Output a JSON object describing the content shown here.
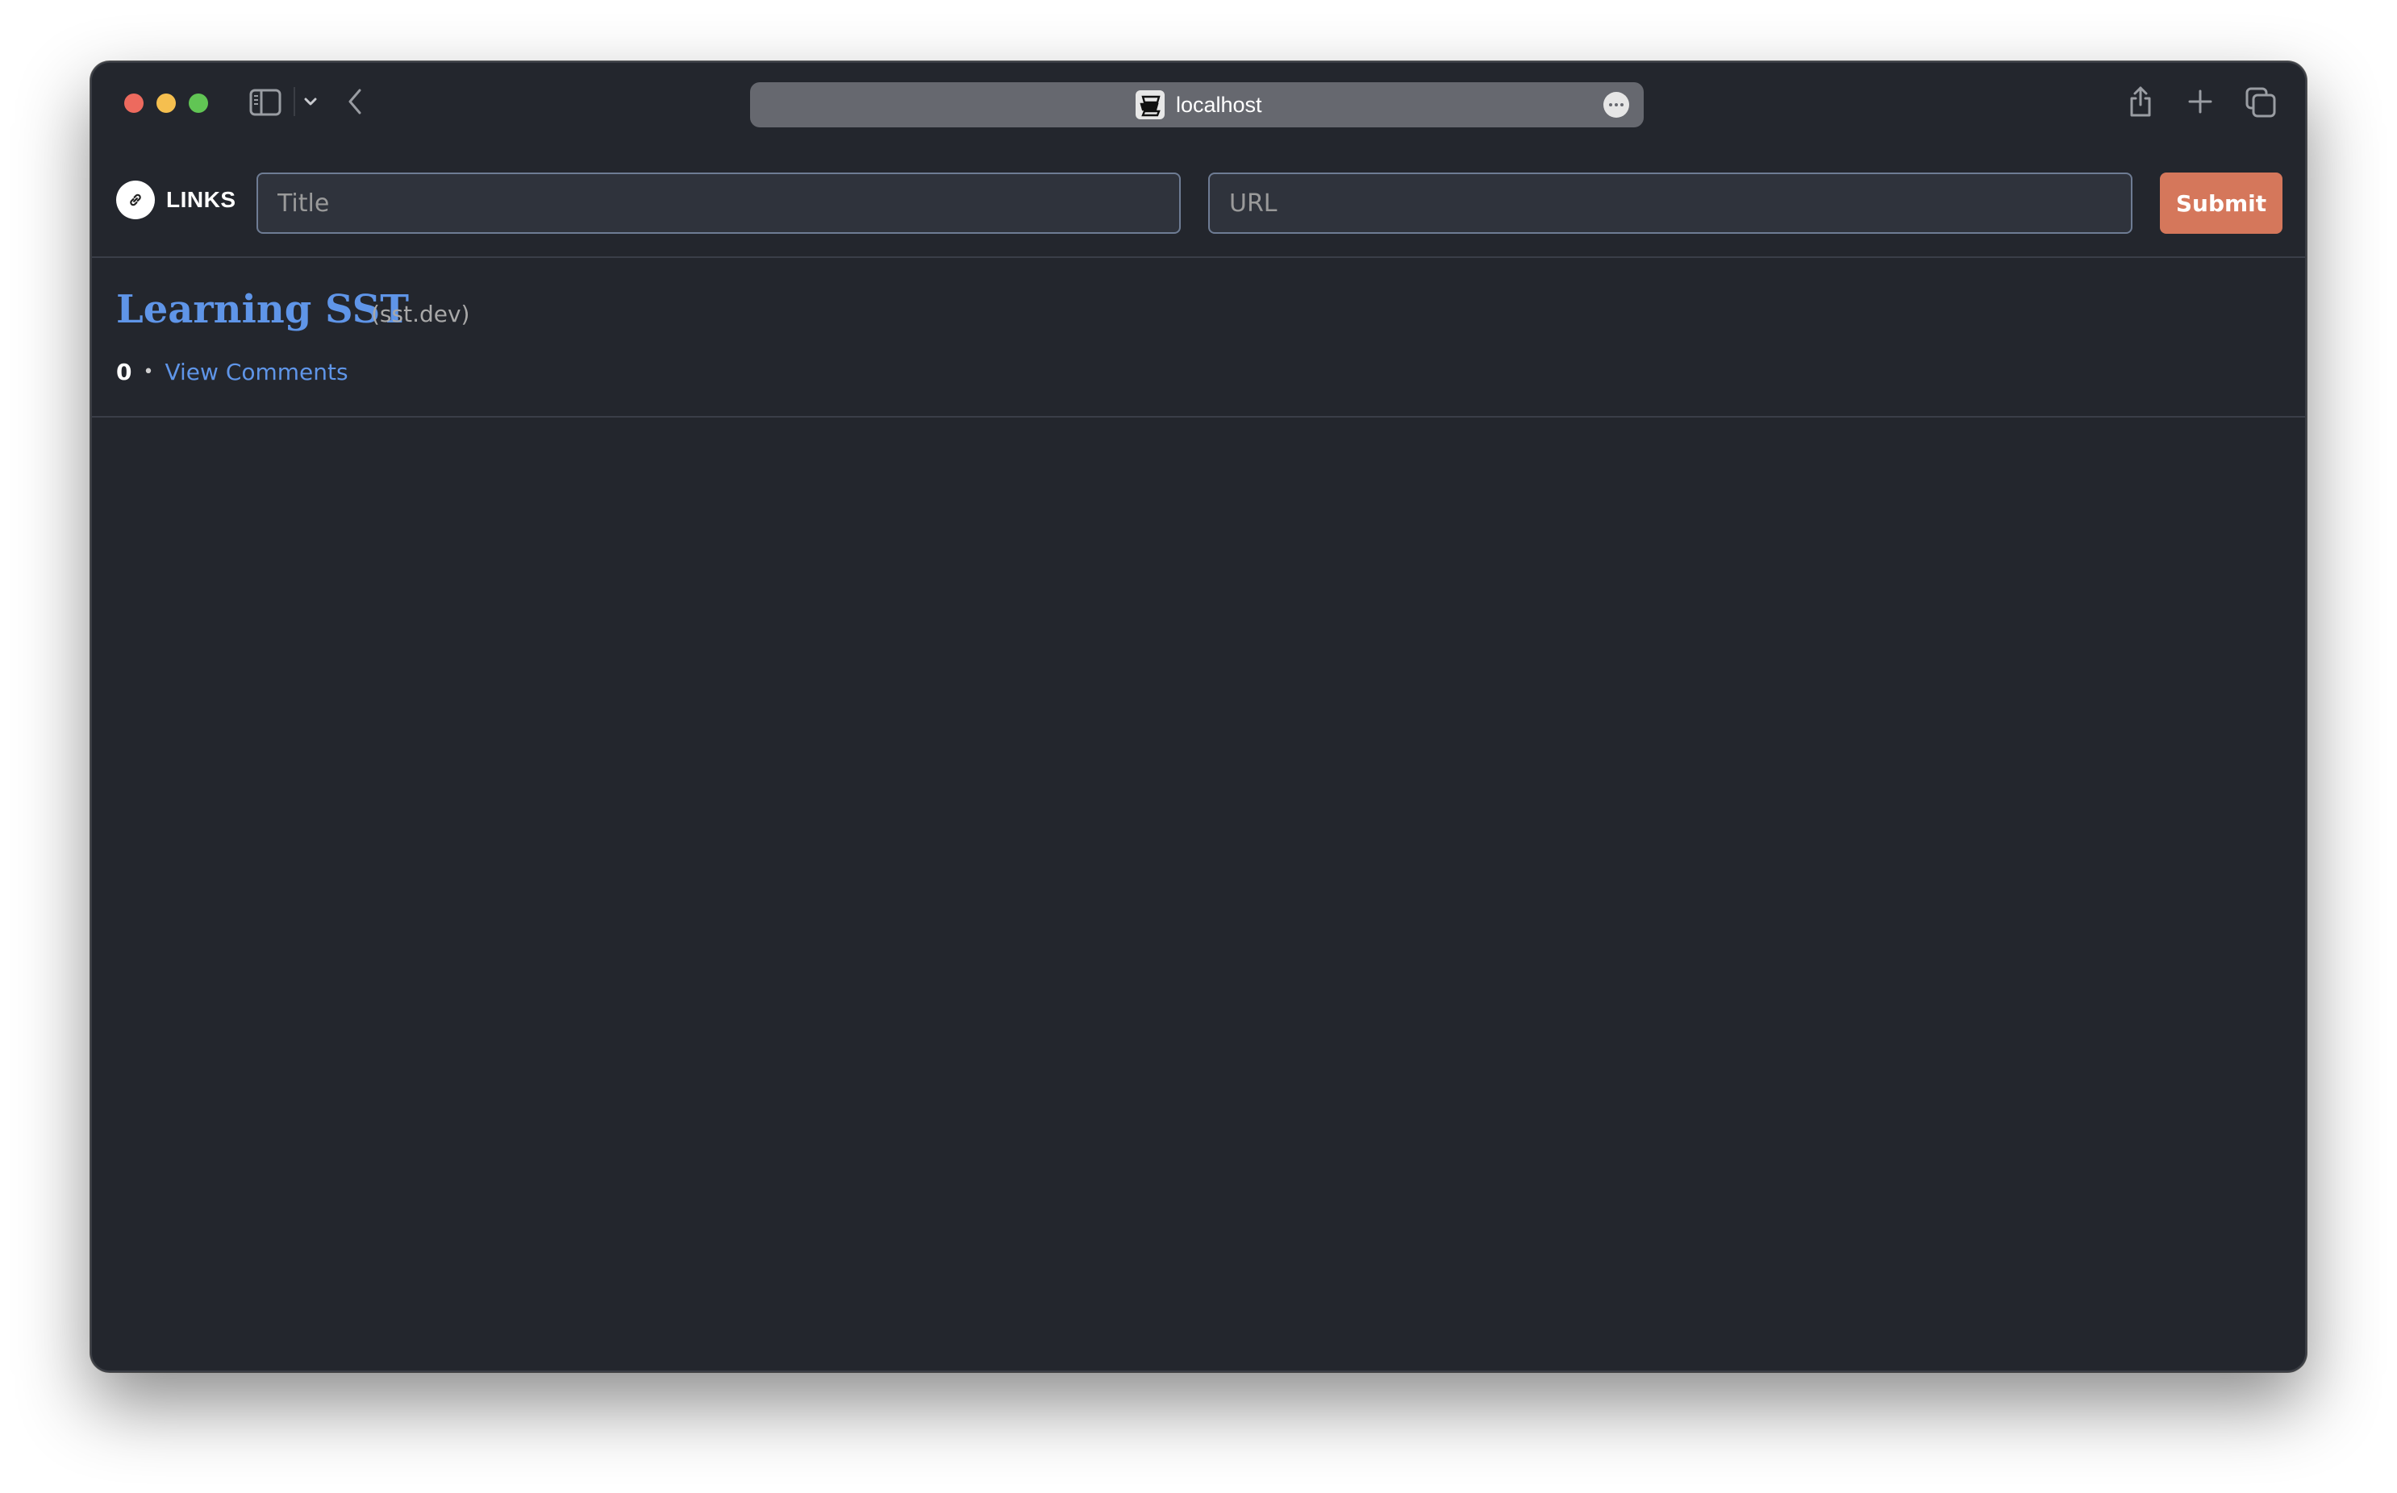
{
  "browser": {
    "address": "localhost",
    "icons": {
      "sidebar": "sidebar-icon",
      "chevron": "chevron-down-icon",
      "back": "back-icon",
      "site": "sst-site-icon",
      "more": "more-icon",
      "share": "share-icon",
      "new_tab": "plus-icon",
      "tabs": "tabs-overview-icon"
    }
  },
  "header": {
    "logo_icon": "link-icon",
    "logo_text": "LINKS",
    "title_placeholder": "Title",
    "title_value": "",
    "url_placeholder": "URL",
    "url_value": "",
    "submit_label": "Submit"
  },
  "links": [
    {
      "title": "Learning SST",
      "domain": "(sst.dev)",
      "count": "0",
      "separator": "•",
      "comments_label": "View Comments"
    }
  ],
  "colors": {
    "background": "#23262d",
    "link": "#5f95e8",
    "submit": "#d5775b",
    "input_border": "#6e7c94"
  }
}
